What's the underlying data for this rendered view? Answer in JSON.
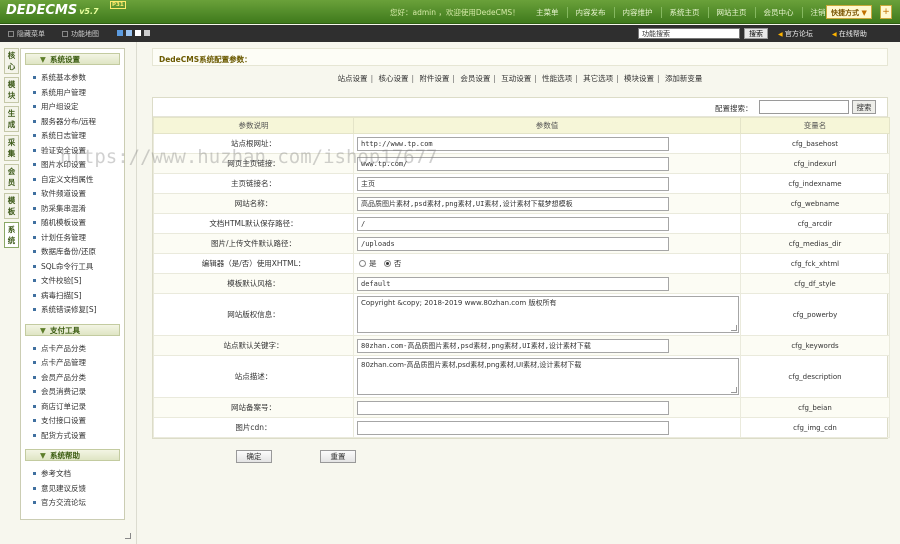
{
  "header": {
    "logo_text": "DEDECMS",
    "version": "v5.7",
    "badge": "P31",
    "welcome": "您好：admin ，欢迎使用DedeCMS！",
    "nav": [
      "主菜单",
      "内容发布",
      "内容维护",
      "系统主页",
      "网站主页",
      "会员中心",
      "注销"
    ],
    "quick_label": "快捷方式",
    "quick_arrow": "▼",
    "plus": "+"
  },
  "subbar": {
    "hide_menu": "隐藏菜单",
    "func_map": "功能地图",
    "search_value": "功能搜索",
    "search_button": "搜索",
    "forum": "官方论坛",
    "help": "在线帮助",
    "swatch_colors": [
      "#5b9be0",
      "#9ac3f0",
      "#ffffff",
      "#cccccc"
    ]
  },
  "vtabs": [
    "核心",
    "模块",
    "生成",
    "采集",
    "会员",
    "模板",
    "系统"
  ],
  "sidebar": {
    "groups": [
      {
        "title": "系统设置",
        "items": [
          "系统基本参数",
          "系统用户管理",
          "用户组设定",
          "服务器分布/远程",
          "系统日志管理",
          "验证安全设置",
          "图片水印设置",
          "自定义文档属性",
          "软件频道设置",
          "防采集串混淆",
          "随机模板设置",
          "计划任务管理",
          "数据库备份/还原",
          "SQL命令行工具",
          "文件校验[S]",
          "病毒扫描[S]",
          "系统错误修复[S]"
        ]
      },
      {
        "title": "支付工具",
        "items": [
          "点卡产品分类",
          "点卡产品管理",
          "会员产品分类",
          "会员消费记录",
          "商店订单记录",
          "支付接口设置",
          "配货方式设置"
        ]
      },
      {
        "title": "系统帮助",
        "items": [
          "参考文档",
          "意见建议反馈",
          "官方交流论坛"
        ]
      }
    ]
  },
  "main": {
    "title": "DedeCMS系统配置参数：",
    "tabs": [
      "站点设置",
      "核心设置",
      "附件设置",
      "会员设置",
      "互动设置",
      "性能选项",
      "其它选项",
      "模块设置",
      "添加新变量"
    ],
    "tab_sep": "|",
    "config_search_label": "配置搜索：",
    "config_search_button": "搜索",
    "columns": [
      "参数说明",
      "参数值",
      "变量名"
    ],
    "rows": [
      {
        "label": "站点根网址：",
        "value": "http://www.tp.com",
        "var": "cfg_basehost",
        "kind": "text"
      },
      {
        "label": "网页主页链接：",
        "value": "www.tp.com/",
        "var": "cfg_indexurl",
        "kind": "text"
      },
      {
        "label": "主页链接名：",
        "value": "主页",
        "var": "cfg_indexname",
        "kind": "text"
      },
      {
        "label": "网站名称：",
        "value": "高品质图片素材,psd素材,png素材,UI素材,设计素材下载梦想模板",
        "var": "cfg_webname",
        "kind": "text"
      },
      {
        "label": "文档HTML默认保存路径：",
        "value": "/",
        "var": "cfg_arcdir",
        "kind": "text"
      },
      {
        "label": "图片/上传文件默认路径：",
        "value": "/uploads",
        "var": "cfg_medias_dir",
        "kind": "text"
      },
      {
        "label": "编辑器（是/否）使用XHTML：",
        "value": "",
        "var": "cfg_fck_xhtml",
        "kind": "radio",
        "options": [
          "是",
          "否"
        ],
        "selected": 1
      },
      {
        "label": "模板默认风格：",
        "value": "default",
        "var": "cfg_df_style",
        "kind": "text"
      },
      {
        "label": "网站版权信息：",
        "value": "Copyright &copy; 2018-2019 www.80zhan.com 版权所有",
        "var": "cfg_powerby",
        "kind": "textarea"
      },
      {
        "label": "站点默认关键字：",
        "value": "80zhan.com-高品质图片素材,psd素材,png素材,UI素材,设计素材下载",
        "var": "cfg_keywords",
        "kind": "text"
      },
      {
        "label": "站点描述：",
        "value": "80zhan.com-高品质图片素材,psd素材,png素材,UI素材,设计素材下载",
        "var": "cfg_description",
        "kind": "textarea"
      },
      {
        "label": "网站备案号：",
        "value": "",
        "var": "cfg_beian",
        "kind": "text"
      },
      {
        "label": "图片cdn：",
        "value": "",
        "var": "cfg_img_cdn",
        "kind": "text"
      }
    ],
    "ok_button": "确定",
    "reset_button": "重置"
  },
  "watermark": "https://www.huzhan.com/ishop17677"
}
